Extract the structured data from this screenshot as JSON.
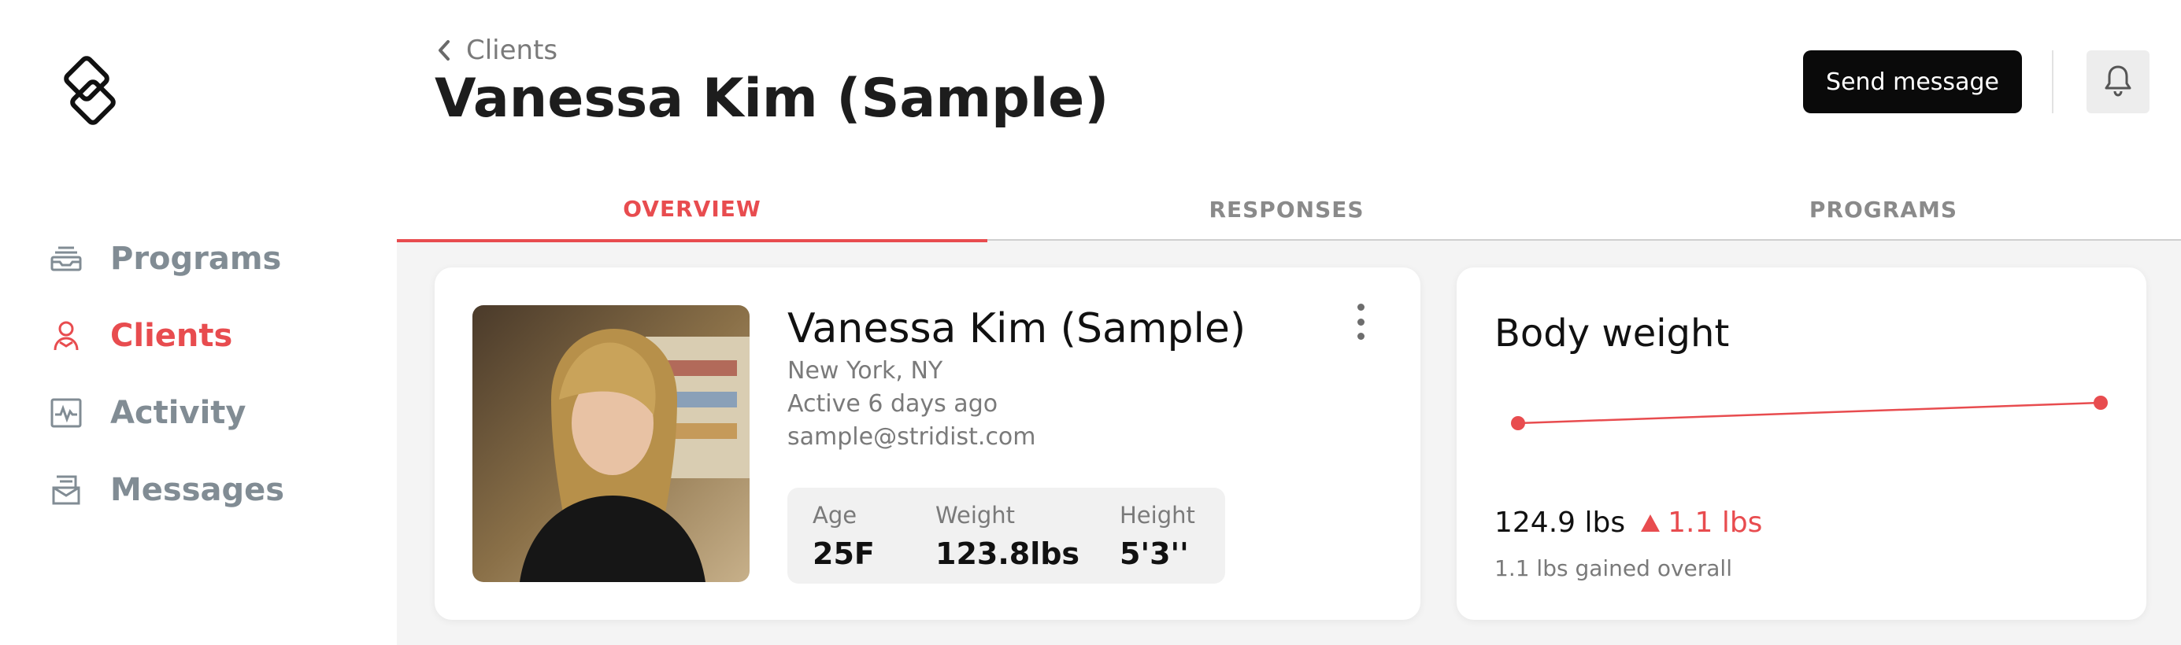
{
  "sidebar": {
    "items": [
      {
        "label": "Programs",
        "icon": "programs-icon",
        "active": false
      },
      {
        "label": "Clients",
        "icon": "clients-icon",
        "active": true
      },
      {
        "label": "Activity",
        "icon": "activity-icon",
        "active": false
      },
      {
        "label": "Messages",
        "icon": "messages-icon",
        "active": false
      }
    ]
  },
  "header": {
    "back_label": "Clients",
    "title": "Vanessa Kim (Sample)",
    "send_message_label": "Send message"
  },
  "tabs": [
    {
      "label": "OVERVIEW",
      "active": true
    },
    {
      "label": "RESPONSES",
      "active": false
    },
    {
      "label": "PROGRAMS",
      "active": false
    }
  ],
  "profile": {
    "name": "Vanessa Kim (Sample)",
    "location": "New York, NY",
    "last_active": "Active 6 days ago",
    "email": "sample@stridist.com",
    "stats": [
      {
        "label": "Age",
        "value": "25F"
      },
      {
        "label": "Weight",
        "value": "123.8lbs"
      },
      {
        "label": "Height",
        "value": "5'3''"
      }
    ]
  },
  "body_weight": {
    "title": "Body weight",
    "current": "124.9 lbs",
    "delta": "1.1 lbs",
    "summary": "1.1 lbs gained overall",
    "points": [
      123.8,
      124.9
    ]
  },
  "colors": {
    "accent": "#e84c4f",
    "primary_button": "#0a0a0a",
    "muted_text": "#7a7a7a",
    "nav_text": "#818c94"
  }
}
